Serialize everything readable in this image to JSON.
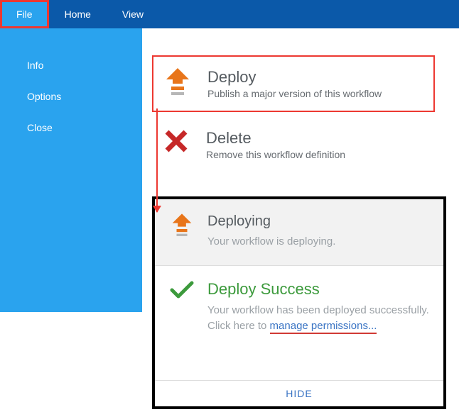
{
  "topbar": {
    "tabs": [
      {
        "label": "File",
        "active": true
      },
      {
        "label": "Home",
        "active": false
      },
      {
        "label": "View",
        "active": false
      }
    ]
  },
  "sidebar": {
    "items": [
      {
        "label": "Info"
      },
      {
        "label": "Options"
      },
      {
        "label": "Close"
      }
    ]
  },
  "actions": {
    "deploy": {
      "title": "Deploy",
      "subtitle": "Publish a major version of this workflow"
    },
    "delete": {
      "title": "Delete",
      "subtitle": "Remove this workflow definition"
    }
  },
  "status": {
    "deploying": {
      "title": "Deploying",
      "subtitle": "Your workflow is deploying."
    },
    "success": {
      "title": "Deploy Success",
      "subtitle_pre": "Your workflow has been deployed successfully. Click here to ",
      "link": "manage permissions..."
    },
    "hide_label": "HIDE"
  }
}
